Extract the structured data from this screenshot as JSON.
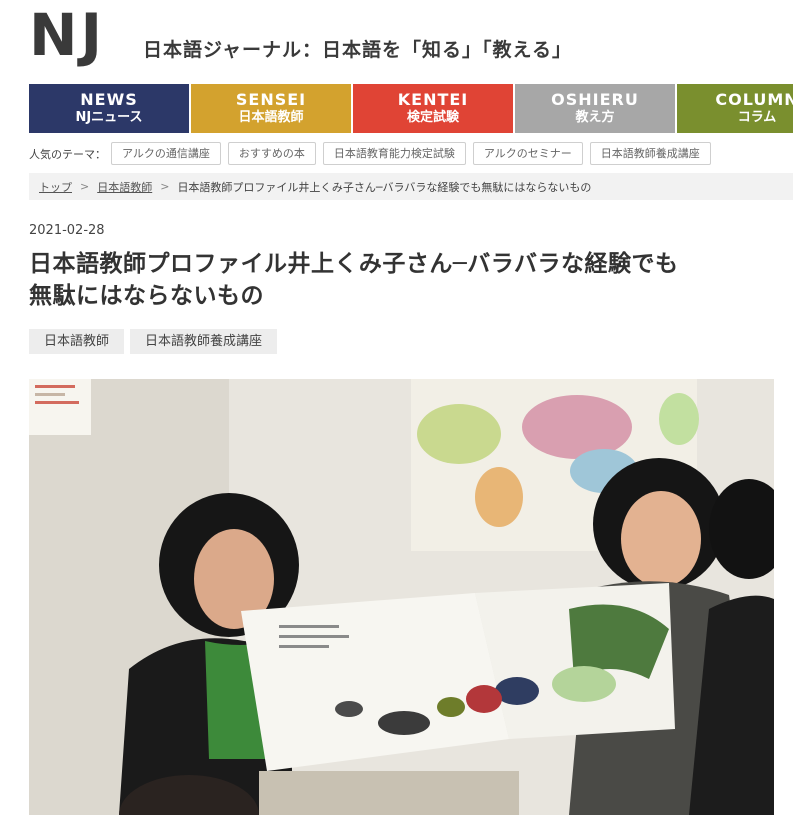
{
  "site": {
    "logo": "NJ",
    "title": "日本語ジャーナル：日本語を「知る」「教える」"
  },
  "nav": [
    {
      "en": "NEWS",
      "jp": "NJニュース",
      "color": "#2c3868"
    },
    {
      "en": "SENSEI",
      "jp": "日本語教師",
      "color": "#d3a22e"
    },
    {
      "en": "KENTEI",
      "jp": "検定試験",
      "color": "#e04435"
    },
    {
      "en": "OSHIERU",
      "jp": "教え方",
      "color": "#a7a7a7"
    },
    {
      "en": "COLUMN",
      "jp": "コラム",
      "color": "#7a8f2e"
    }
  ],
  "popular": {
    "label": "人気のテーマ：",
    "tags": [
      "アルクの通信講座",
      "おすすめの本",
      "日本語教育能力検定試験",
      "アルクのセミナー",
      "日本語教師養成講座"
    ]
  },
  "breadcrumb": {
    "items": [
      "トップ",
      "日本語教師"
    ],
    "current": "日本語教師プロファイル井上くみ子さん─バラバラな経験でも無駄にはならないもの"
  },
  "article": {
    "date": "2021-02-28",
    "title_line1": "日本語教師プロファイル井上くみ子さん─バラバラな経験でも",
    "title_line2": "無駄にはならないもの",
    "tags": [
      "日本語教師",
      "日本語教師養成講座"
    ]
  }
}
